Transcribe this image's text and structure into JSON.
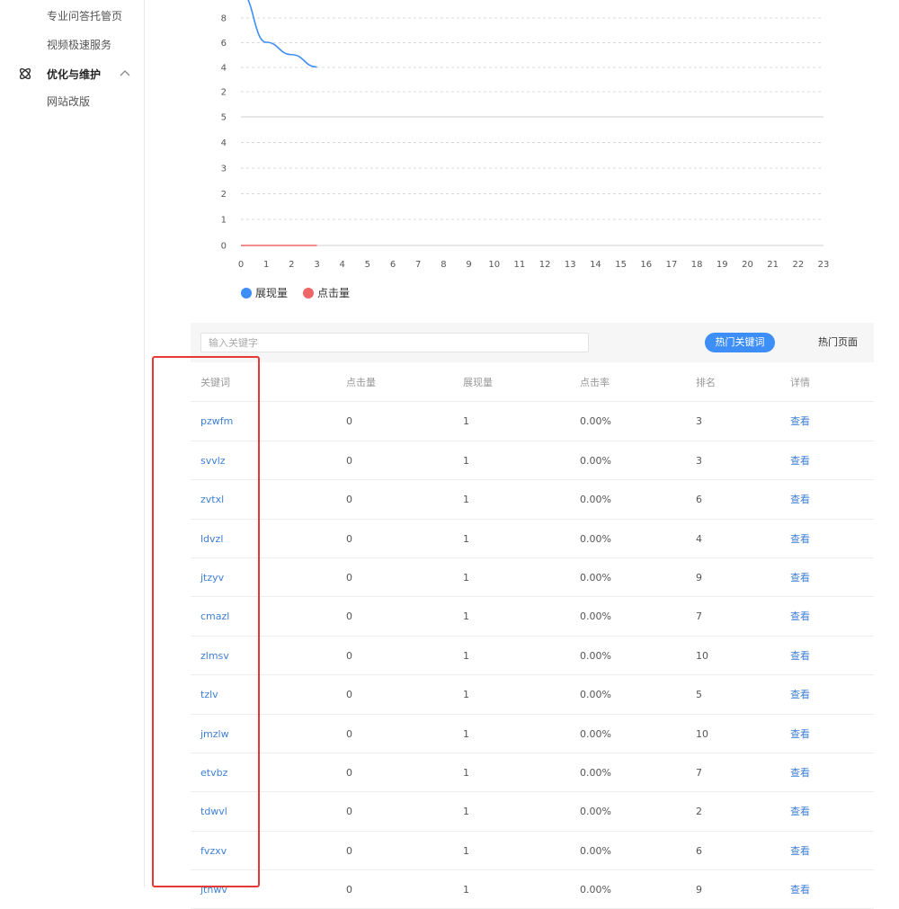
{
  "sidebar": {
    "items": [
      {
        "label": "专业问答托管页"
      },
      {
        "label": "视频极速服务"
      }
    ],
    "group": {
      "label": "优化与维护",
      "icon": "atom-icon",
      "expanded": true
    },
    "sub_items": [
      {
        "label": "网站改版"
      }
    ]
  },
  "chart_data": {
    "type": "line",
    "x": [
      0,
      1,
      2,
      3,
      4,
      5,
      6,
      7,
      8,
      9,
      10,
      11,
      12,
      13,
      14,
      15,
      16,
      17,
      18,
      19,
      20,
      21,
      22,
      23
    ],
    "upper_axis": {
      "ticks": [
        "8",
        "6",
        "4",
        "2"
      ]
    },
    "lower_axis": {
      "ticks": [
        "5",
        "4",
        "3",
        "2",
        "1",
        "0"
      ]
    },
    "series": [
      {
        "name": "展现量",
        "color": "#3e8ef7",
        "x": [
          0,
          1,
          2,
          3
        ],
        "values": [
          10,
          6,
          5,
          4
        ]
      },
      {
        "name": "点击量",
        "color": "#ee6666",
        "x": [
          0,
          1,
          2,
          3
        ],
        "values": [
          0,
          0,
          0,
          0
        ]
      }
    ],
    "legend": "bottom-left",
    "grid": true
  },
  "toolbar": {
    "search_placeholder": "输入关键字",
    "tab_hot_keywords": "热门关键词",
    "tab_hot_pages": "热门页面"
  },
  "table": {
    "headers": [
      "关键词",
      "点击量",
      "展现量",
      "点击率",
      "排名",
      "详情"
    ],
    "rows": [
      [
        "pzwfm",
        "0",
        "1",
        "0.00%",
        "3",
        "查看"
      ],
      [
        "svvlz",
        "0",
        "1",
        "0.00%",
        "3",
        "查看"
      ],
      [
        "zvtxl",
        "0",
        "1",
        "0.00%",
        "6",
        "查看"
      ],
      [
        "ldvzl",
        "0",
        "1",
        "0.00%",
        "4",
        "查看"
      ],
      [
        "jtzyv",
        "0",
        "1",
        "0.00%",
        "9",
        "查看"
      ],
      [
        "cmazl",
        "0",
        "1",
        "0.00%",
        "7",
        "查看"
      ],
      [
        "zlmsv",
        "0",
        "1",
        "0.00%",
        "10",
        "查看"
      ],
      [
        "tzlv",
        "0",
        "1",
        "0.00%",
        "5",
        "查看"
      ],
      [
        "jmzlw",
        "0",
        "1",
        "0.00%",
        "10",
        "查看"
      ],
      [
        "etvbz",
        "0",
        "1",
        "0.00%",
        "7",
        "查看"
      ],
      [
        "tdwvl",
        "0",
        "1",
        "0.00%",
        "2",
        "查看"
      ],
      [
        "fvzxv",
        "0",
        "1",
        "0.00%",
        "6",
        "查看"
      ],
      [
        "jtnwv",
        "0",
        "1",
        "0.00%",
        "9",
        "查看"
      ]
    ]
  },
  "colors": {
    "accent": "#3e8ef7",
    "link": "#3e7fd6",
    "highlight": "#e53935"
  }
}
